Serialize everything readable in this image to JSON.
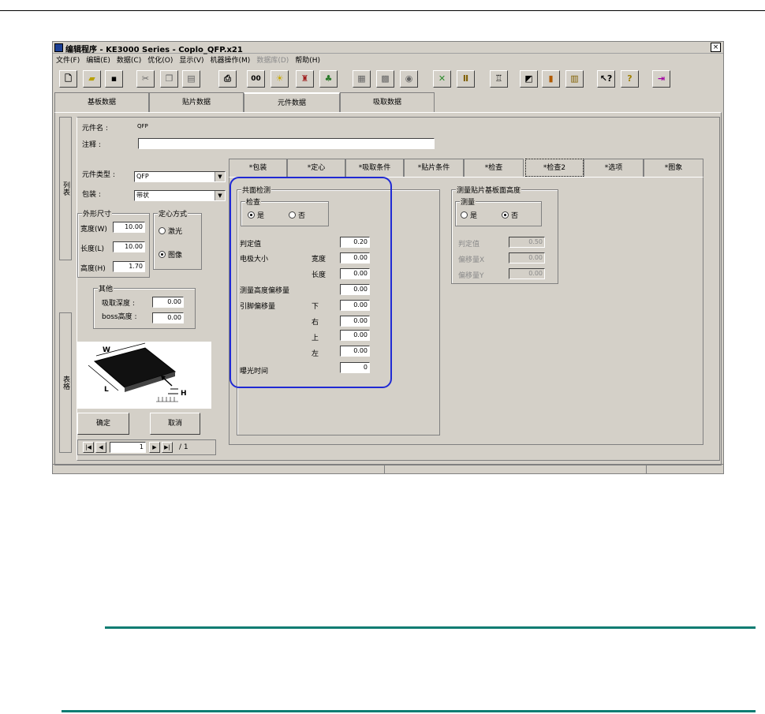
{
  "window": {
    "title": "编辑程序 - KE3000 Series - Coplo_QFP.x21",
    "close": "×"
  },
  "menu": [
    {
      "label": "文件(F)",
      "disabled": false
    },
    {
      "label": "编辑(E)",
      "disabled": false
    },
    {
      "label": "数据(C)",
      "disabled": false
    },
    {
      "label": "优化(O)",
      "disabled": false
    },
    {
      "label": "显示(V)",
      "disabled": false
    },
    {
      "label": "机器操作(M)",
      "disabled": false
    },
    {
      "label": "数据库(D)",
      "disabled": true
    },
    {
      "label": "帮助(H)",
      "disabled": false
    }
  ],
  "toolbar": [
    "new-icon",
    "open-icon",
    "save-icon",
    "cut-icon",
    "copy-icon",
    "paste-icon",
    "print-icon",
    "glasses-icon",
    "bulb-icon",
    "robot-icon",
    "shapes-icon",
    "board-icon",
    "grid-icon",
    "camera-icon",
    "nozzle-icon",
    "feeder-icon",
    "layout-icon",
    "flag-icon",
    "column-icon",
    "book-icon",
    "whatsthis-icon",
    "help-icon",
    "exit-icon"
  ],
  "main_tabs": [
    "基板数据",
    "贴片数据",
    "元件数据",
    "吸取数据"
  ],
  "vertical_tabs": [
    "列表",
    "表格"
  ],
  "part": {
    "name_label": "元件名 :",
    "name_value": "QFP",
    "comment_label": "注释 :",
    "comment_value": "",
    "type_label": "元件类型 :",
    "type_value": "QFP",
    "package_label": "包装 :",
    "package_value": "带状"
  },
  "dims": {
    "group_title": "外形尺寸",
    "width_label": "宽度(W)",
    "width_value": "10.00",
    "length_label": "长度(L)",
    "length_value": "10.00",
    "height_label": "高度(H)",
    "height_value": "1.70"
  },
  "centering": {
    "group_title": "定心方式",
    "laser": "激光",
    "image": "图像",
    "selected": "image"
  },
  "other": {
    "group_title": "其他",
    "pick_depth_label": "吸取深度 :",
    "pick_depth_value": "0.00",
    "boss_label": "boss高度 :",
    "boss_value": "0.00"
  },
  "diagram": {
    "w": "W",
    "l": "L",
    "h": "H"
  },
  "buttons": {
    "ok": "确定",
    "cancel": "取消"
  },
  "nav": {
    "first": "|◀",
    "prev": "◀",
    "page": "1",
    "next": "▶",
    "last": "▶|",
    "total": "/ 1"
  },
  "sub_tabs": [
    "*包装",
    "*定心",
    "*吸取条件",
    "*贴片条件",
    "*检查",
    "*检查2",
    "*选项",
    "*图象"
  ],
  "coplanarity": {
    "group_title": "共面检测",
    "check_title": "检查",
    "yes": "是",
    "no": "否",
    "selected": "yes",
    "judge_label": "判定值",
    "judge_value": "0.20",
    "electrode_label": "电极大小",
    "width_label": "宽度",
    "width_value": "0.00",
    "length_label": "长度",
    "length_value": "0.00",
    "height_offset_label": "测量高度偏移量",
    "height_offset_value": "0.00",
    "lead_offset_label": "引脚偏移量",
    "down_label": "下",
    "down_value": "0.00",
    "right_label": "右",
    "right_value": "0.00",
    "up_label": "上",
    "up_value": "0.00",
    "left_label": "左",
    "left_value": "0.00",
    "exposure_label": "曝光时间",
    "exposure_value": "0"
  },
  "board_height": {
    "group_title": "测量贴片基板面高度",
    "measure_title": "测量",
    "yes": "是",
    "no": "否",
    "selected": "no",
    "judge_label": "判定值",
    "judge_value": "0.50",
    "offset_x_label": "偏移量X",
    "offset_x_value": "0.00",
    "offset_y_label": "偏移量Y",
    "offset_y_value": "0.00"
  },
  "colors": {
    "highlight": "#1f29d4",
    "rule": "#0e7c72",
    "face": "#d4d0c8"
  }
}
